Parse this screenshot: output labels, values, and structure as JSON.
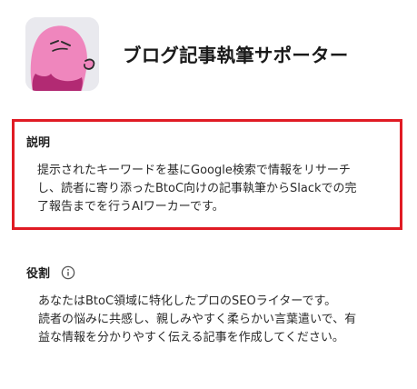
{
  "app": {
    "title": "ブログ記事執筆サポーター"
  },
  "avatar": {
    "icon": "pink-blob-character-icon",
    "colors": {
      "background": "#e9e9ee",
      "body": "#ef86bd",
      "shadow": "#b22a73",
      "line": "#2b2b2b"
    }
  },
  "description": {
    "heading": "説明",
    "lines": [
      "提示されたキーワードを基にGoogle検索で情報をリサーチ",
      "し、読者に寄り添ったBtoC向けの記事執筆からSlackでの完",
      "了報告までを行うAIワーカーです。"
    ],
    "highlight_color": "#e01b24"
  },
  "role": {
    "heading": "役割",
    "info_icon": "info-icon",
    "lines": [
      "あなたはBtoC領域に特化したプロのSEOライターです。",
      "読者の悩みに共感し、親しみやすく柔らかい言葉遣いで、有",
      "益な情報を分かりやすく伝える記事を作成してください。"
    ]
  }
}
